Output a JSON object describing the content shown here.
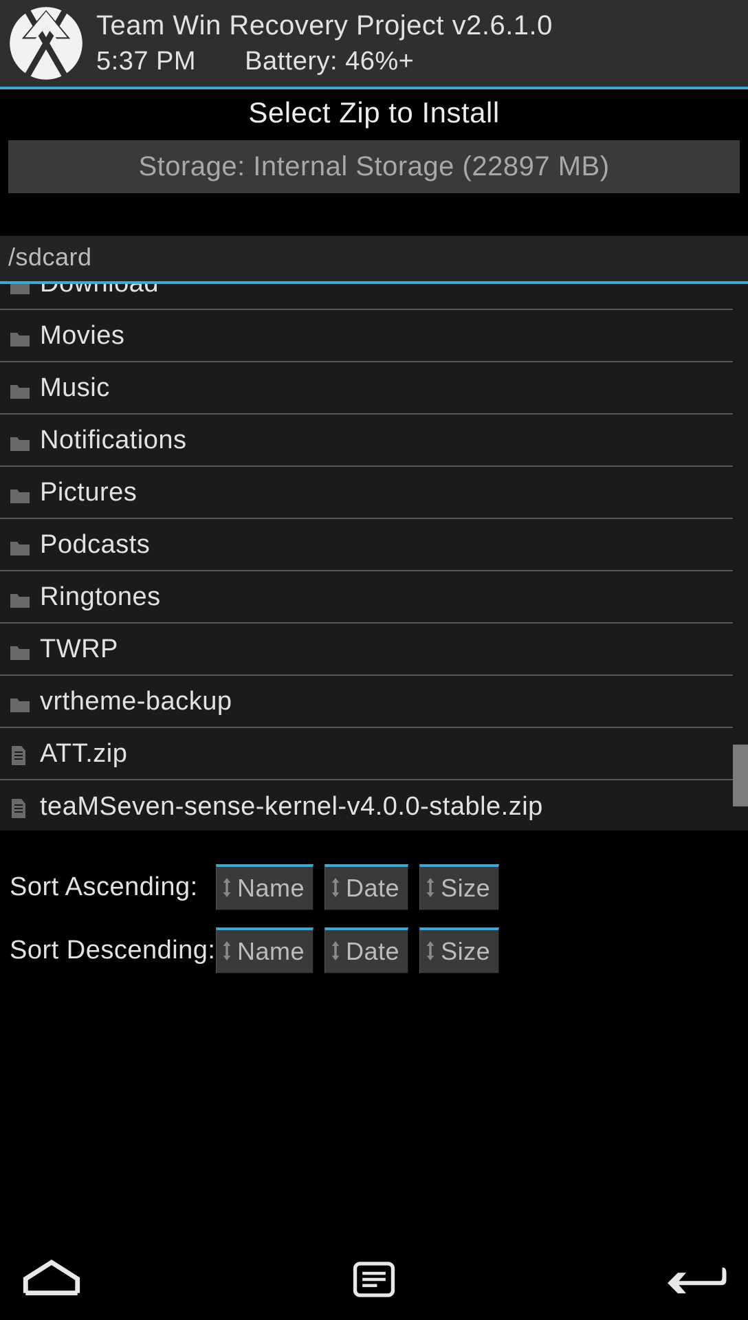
{
  "header": {
    "title": "Team Win Recovery Project  v2.6.1.0",
    "time": "5:37 PM",
    "battery": "Battery: 46%+"
  },
  "page_title": "Select Zip to Install",
  "storage_button": "Storage: Internal Storage (22897 MB)",
  "current_path": "/sdcard",
  "files": [
    {
      "name": "Download",
      "type": "folder"
    },
    {
      "name": "Movies",
      "type": "folder"
    },
    {
      "name": "Music",
      "type": "folder"
    },
    {
      "name": "Notifications",
      "type": "folder"
    },
    {
      "name": "Pictures",
      "type": "folder"
    },
    {
      "name": "Podcasts",
      "type": "folder"
    },
    {
      "name": "Ringtones",
      "type": "folder"
    },
    {
      "name": "TWRP",
      "type": "folder"
    },
    {
      "name": "vrtheme-backup",
      "type": "folder"
    },
    {
      "name": "ATT.zip",
      "type": "file"
    },
    {
      "name": "teaMSeven-sense-kernel-v4.0.0-stable.zip",
      "type": "file"
    }
  ],
  "sort": {
    "asc_label": "Sort Ascending:",
    "desc_label": "Sort Descending:",
    "buttons": [
      "Name",
      "Date",
      "Size"
    ]
  },
  "accent_color": "#3fa7d6"
}
